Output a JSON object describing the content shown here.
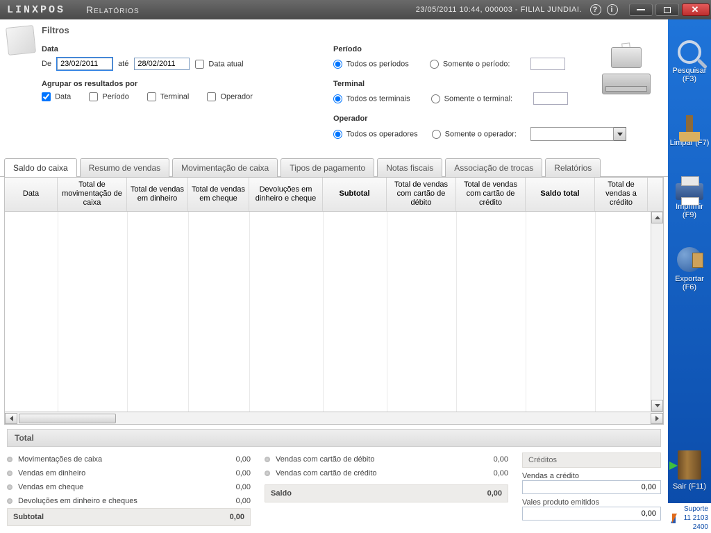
{
  "titlebar": {
    "brand": "LINXPOS",
    "section": "Relatórios",
    "status": "23/05/2011 10:44, 000003 - FILIAL JUNDIAI.",
    "help": "?",
    "info": "i"
  },
  "sidebar": {
    "search": "Pesquisar (F3)",
    "clear": "Limpar (F7)",
    "print": "Imprimir (F9)",
    "export": "Exportar (F6)",
    "exit": "Sair (F11)",
    "support_label": "Suporte",
    "support_phone": "11 2103 2400"
  },
  "filters": {
    "title": "Filtros",
    "data_label": "Data",
    "de": "De",
    "ate": "até",
    "date_from": "23/02/2011",
    "date_to": "28/02/2011",
    "data_atual": "Data atual",
    "group_label": "Agrupar os resultados por",
    "group": {
      "data": "Data",
      "periodo": "Período",
      "terminal": "Terminal",
      "operador": "Operador"
    },
    "periodo_label": "Período",
    "periodo_all": "Todos os períodos",
    "periodo_one": "Somente o período:",
    "terminal_label": "Terminal",
    "terminal_all": "Todos os terminais",
    "terminal_one": "Somente o terminal:",
    "operador_label": "Operador",
    "operador_all": "Todos os operadores",
    "operador_one": "Somente o operador:"
  },
  "tabs": {
    "saldo": "Saldo do caixa",
    "resumo": "Resumo de vendas",
    "mov": "Movimentação de caixa",
    "tipos": "Tipos de pagamento",
    "notas": "Notas fiscais",
    "assoc": "Associação de trocas",
    "relat": "Relatórios"
  },
  "grid": {
    "h_data": "Data",
    "h_mov": "Total de movimentação de caixa",
    "h_din": "Total de vendas em dinheiro",
    "h_chq": "Total de vendas em cheque",
    "h_dev": "Devoluções em dinheiro e cheque",
    "h_sub": "Subtotal",
    "h_deb": "Total de vendas com cartão de débito",
    "h_crecard": "Total de vendas com cartão de crédito",
    "h_saldo": "Saldo total",
    "h_cred": "Total de vendas a crédito"
  },
  "totals": {
    "title": "Total",
    "mov": {
      "label": "Movimentações de caixa",
      "value": "0,00"
    },
    "din": {
      "label": "Vendas em dinheiro",
      "value": "0,00"
    },
    "chq": {
      "label": "Vendas em cheque",
      "value": "0,00"
    },
    "dev": {
      "label": "Devoluções em dinheiro e cheques",
      "value": "0,00"
    },
    "sub": {
      "label": "Subtotal",
      "value": "0,00"
    },
    "deb": {
      "label": "Vendas com cartão de débito",
      "value": "0,00"
    },
    "crd": {
      "label": "Vendas com cartão de crédito",
      "value": "0,00"
    },
    "saldo": {
      "label": "Saldo",
      "value": "0,00"
    },
    "credhdr": "Créditos",
    "vcred": {
      "label": "Vendas a crédito",
      "value": "0,00"
    },
    "vales": {
      "label": "Vales produto emitidos",
      "value": "0,00"
    }
  }
}
